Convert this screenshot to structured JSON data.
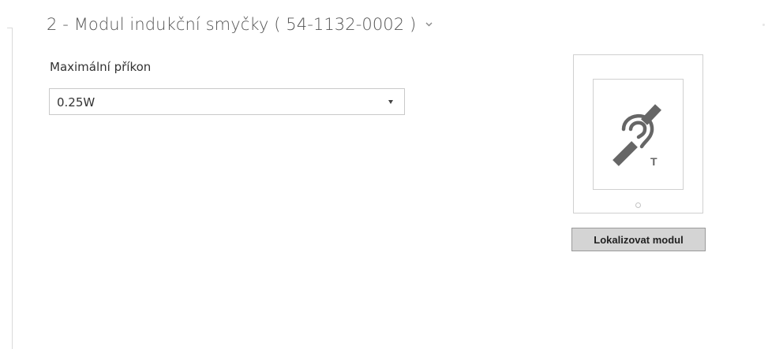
{
  "section": {
    "title": "2 - Modul indukční smyčky ( 54-1132-0002 )",
    "collapse_icon": "chevron-down-icon"
  },
  "power_field": {
    "label": "Maximální příkon",
    "selected_value": "0.25W",
    "arrow_icon": "dropdown-arrow-icon"
  },
  "module_preview": {
    "icon": "hearing-loop-icon",
    "icon_letter": "T",
    "accent_color": "#666666"
  },
  "actions": {
    "locate_label": "Lokalizovat modul"
  }
}
